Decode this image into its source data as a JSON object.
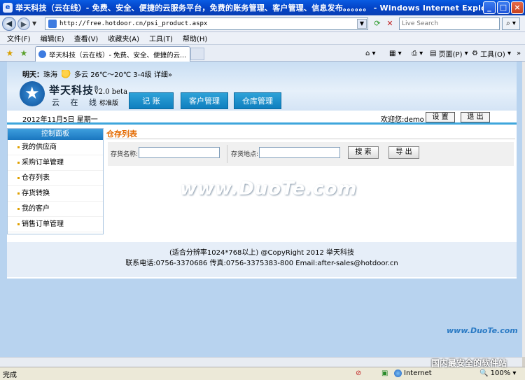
{
  "window": {
    "title": "举天科技（云在线）- 免费、安全、便捷的云服务平台，免费的账务管理、客户管理、信息发布。。。。。。 - Windows Internet Explorer"
  },
  "address_bar": {
    "url": "http://free.hotdoor.cn/psi_product.aspx",
    "search_placeholder": "Live Search"
  },
  "menu": [
    "文件(F)",
    "编辑(E)",
    "查看(V)",
    "收藏夹(A)",
    "工具(T)",
    "帮助(H)"
  ],
  "tab": {
    "label": "举天科技（云在线）- 免费、安全、便捷的云..."
  },
  "command_bar": {
    "page_label": "页面(P)",
    "tools_label": "工具(O)"
  },
  "header": {
    "weather_prefix": "明天：",
    "city": "珠海",
    "condition": "多云",
    "temp": "26℃～20℃",
    "wind": "3-4级",
    "detail_link": "详细»",
    "brand": "举天科技",
    "brand_sub": "云 在 线",
    "version": "v2.0 beta",
    "edition": "标准版",
    "nav_tabs": [
      "记 账",
      "客户管理",
      "仓库管理"
    ]
  },
  "infobar": {
    "date": "2012年11月5日 星期一",
    "welcome": "欢迎您:demo",
    "settings_label": "设 置",
    "logout_label": "退 出"
  },
  "sidebar": {
    "title": "控制面板",
    "items": [
      "我的供应商",
      "采购订单管理",
      "仓存列表",
      "存货转换",
      "我的客户",
      "销售订单管理"
    ]
  },
  "content": {
    "title": "仓存列表",
    "name_label": "存货名称:",
    "location_label": "存货地点:",
    "search_button": "搜 索",
    "export_button": "导 出"
  },
  "footer": {
    "line1": "(适合分辨率1024*768以上) @CopyRight 2012 举天科技",
    "line2": "联系电话:0756-3370686 传真:0756-3375383-800 Email:after-sales@hotdoor.cn"
  },
  "watermark": {
    "main": "www.DuoTe.com",
    "corner_url": "www.DuoTe.com",
    "corner_text": "国内最安全的软件站"
  },
  "status": {
    "text": "完成",
    "zone": "Internet",
    "zoom": "100%"
  }
}
